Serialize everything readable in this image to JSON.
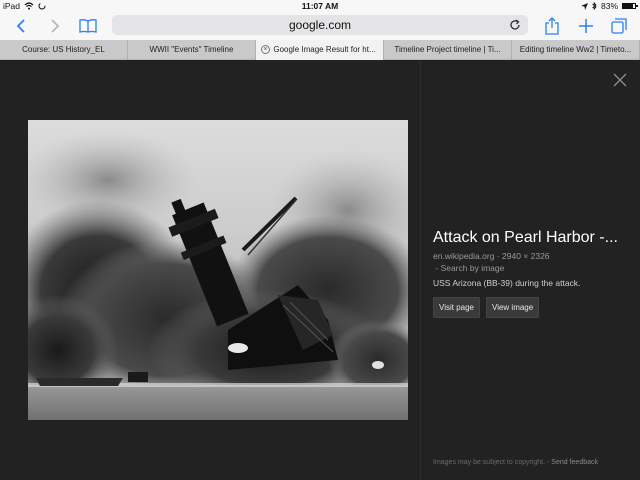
{
  "status": {
    "device": "iPad",
    "time": "11:07 AM",
    "battery_percent": "83%",
    "battery_level": 0.83
  },
  "navbar": {
    "url": "google.com",
    "accent_color": "#2a7ff5"
  },
  "tabs": [
    {
      "label": "Course: US History_EL",
      "active": false
    },
    {
      "label": "WWII \"Events\" Timeline",
      "active": false
    },
    {
      "label": "Google Image Result for ht...",
      "active": true
    },
    {
      "label": "Timeline Project timeline | Ti...",
      "active": false
    },
    {
      "label": "Editing timeline Ww2 | Timeto...",
      "active": false
    }
  ],
  "result": {
    "title": "Attack on Pearl Harbor -...",
    "source": "en.wikipedia.org",
    "dimensions": "2940 × 2326",
    "search_by_image": "Search by image",
    "description": "USS Arizona (BB-39) during the attack.",
    "visit_page": "Visit page",
    "view_image": "View image"
  },
  "footer": {
    "copyright": "Images may be subject to copyright.",
    "send_feedback": "Send feedback"
  },
  "icons": {
    "back": "chevron-left-icon",
    "forward": "chevron-right-icon",
    "bookmarks": "book-icon",
    "reload": "reload-icon",
    "share": "share-icon",
    "new_tab": "plus-icon",
    "tabs_overview": "tabs-icon",
    "close": "close-icon"
  }
}
